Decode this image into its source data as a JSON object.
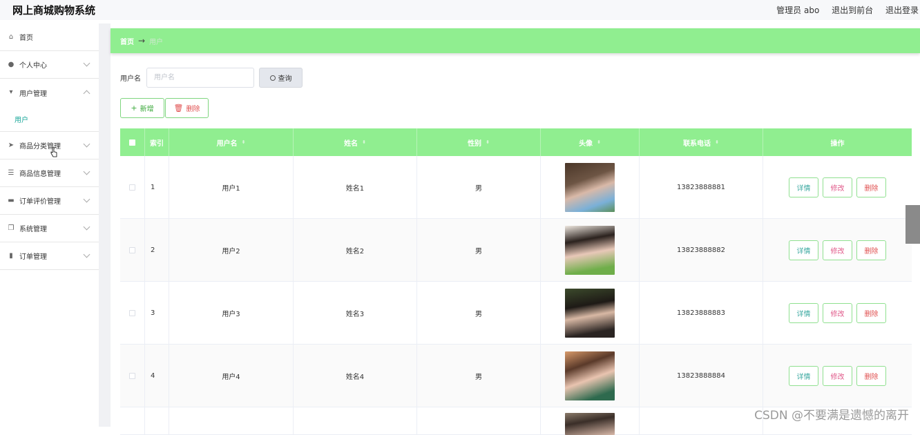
{
  "app": {
    "title": "网上商城购物系统"
  },
  "topbar": {
    "admin": "管理员 abo",
    "back_front": "退出到前台",
    "logout": "退出登录"
  },
  "sidebar": {
    "items": [
      {
        "label": "首页",
        "icon": "home-icon"
      },
      {
        "label": "个人中心",
        "icon": "user-icon"
      },
      {
        "label": "用户管理",
        "icon": "user-manage-icon",
        "expanded": true,
        "sub": "用户"
      },
      {
        "label": "商品分类管理",
        "icon": "paper-plane-icon"
      },
      {
        "label": "商品信息管理",
        "icon": "list-icon"
      },
      {
        "label": "订单评价管理",
        "icon": "monitor-icon"
      },
      {
        "label": "系统管理",
        "icon": "copy-icon"
      },
      {
        "label": "订单管理",
        "icon": "chart-icon"
      }
    ]
  },
  "breadcrumb": {
    "home": "首页",
    "arrow": "→",
    "current": "用户"
  },
  "search": {
    "label": "用户名",
    "placeholder": "用户名",
    "button": "查询"
  },
  "actions": {
    "add": "新增",
    "delete": "删除"
  },
  "table": {
    "columns": [
      "索引",
      "用户名",
      "姓名",
      "性别",
      "头像",
      "联系电话",
      "操作"
    ],
    "rows": [
      {
        "index": "1",
        "username": "用户1",
        "name": "姓名1",
        "sex": "男",
        "phone": "13823888881"
      },
      {
        "index": "2",
        "username": "用户2",
        "name": "姓名2",
        "sex": "男",
        "phone": "13823888882"
      },
      {
        "index": "3",
        "username": "用户3",
        "name": "姓名3",
        "sex": "男",
        "phone": "13823888883"
      },
      {
        "index": "4",
        "username": "用户4",
        "name": "姓名4",
        "sex": "男",
        "phone": "13823888884"
      }
    ],
    "ops": {
      "detail": "详情",
      "edit": "修改",
      "delete": "删除"
    }
  },
  "watermark": "CSDN @不要满是遗憾的离开",
  "colors": {
    "accent": "#90ee90",
    "teal": "#1aa79a",
    "danger": "#e05050"
  }
}
